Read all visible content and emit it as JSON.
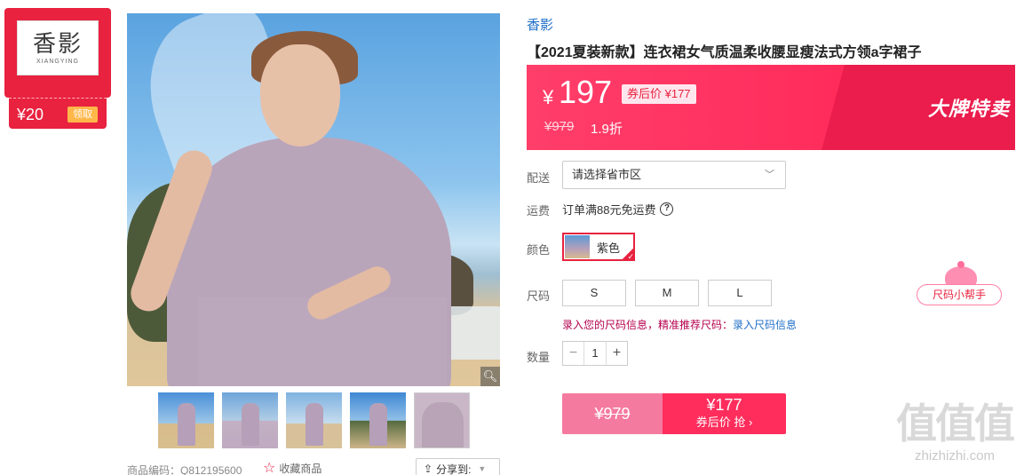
{
  "store": {
    "logo_text": "香影",
    "logo_sub": "XIANGYING",
    "coupon_value": "¥20",
    "coupon_claim": "领取"
  },
  "gallery": {
    "thumbnails": [
      "thumb-1",
      "thumb-2",
      "thumb-3",
      "thumb-4",
      "thumb-5"
    ]
  },
  "meta": {
    "sku": "商品编码：Q812195600",
    "favorite": "收藏商品",
    "share": "分享到:"
  },
  "product": {
    "brand": "香影",
    "title": "【2021夏装新款】连衣裙女气质温柔收腰显瘦法式方领a字裙子"
  },
  "price": {
    "currency": "¥",
    "current": "197",
    "after_coupon": "券后价 ¥177",
    "original": "¥979",
    "discount": "1.9折",
    "promo_tag": "大牌特卖"
  },
  "delivery": {
    "label": "配送",
    "region_placeholder": "请选择省市区"
  },
  "shipping": {
    "label": "运费",
    "text": "订单满88元免运费"
  },
  "color": {
    "label": "颜色",
    "selected": "紫色"
  },
  "size": {
    "label": "尺码",
    "options": [
      "S",
      "M",
      "L"
    ],
    "helper": "尺码小帮手",
    "hint": "录入您的尺码信息，精准推荐尺码：",
    "hint_link": "录入尺码信息"
  },
  "quantity": {
    "label": "数量",
    "value": "1",
    "minus": "−",
    "plus": "+"
  },
  "buy": {
    "original": "¥979",
    "price": "¥177",
    "action": "券后价 抢 ›"
  },
  "watermark": {
    "big": "值值值",
    "small": "zhizhizhi.com"
  }
}
